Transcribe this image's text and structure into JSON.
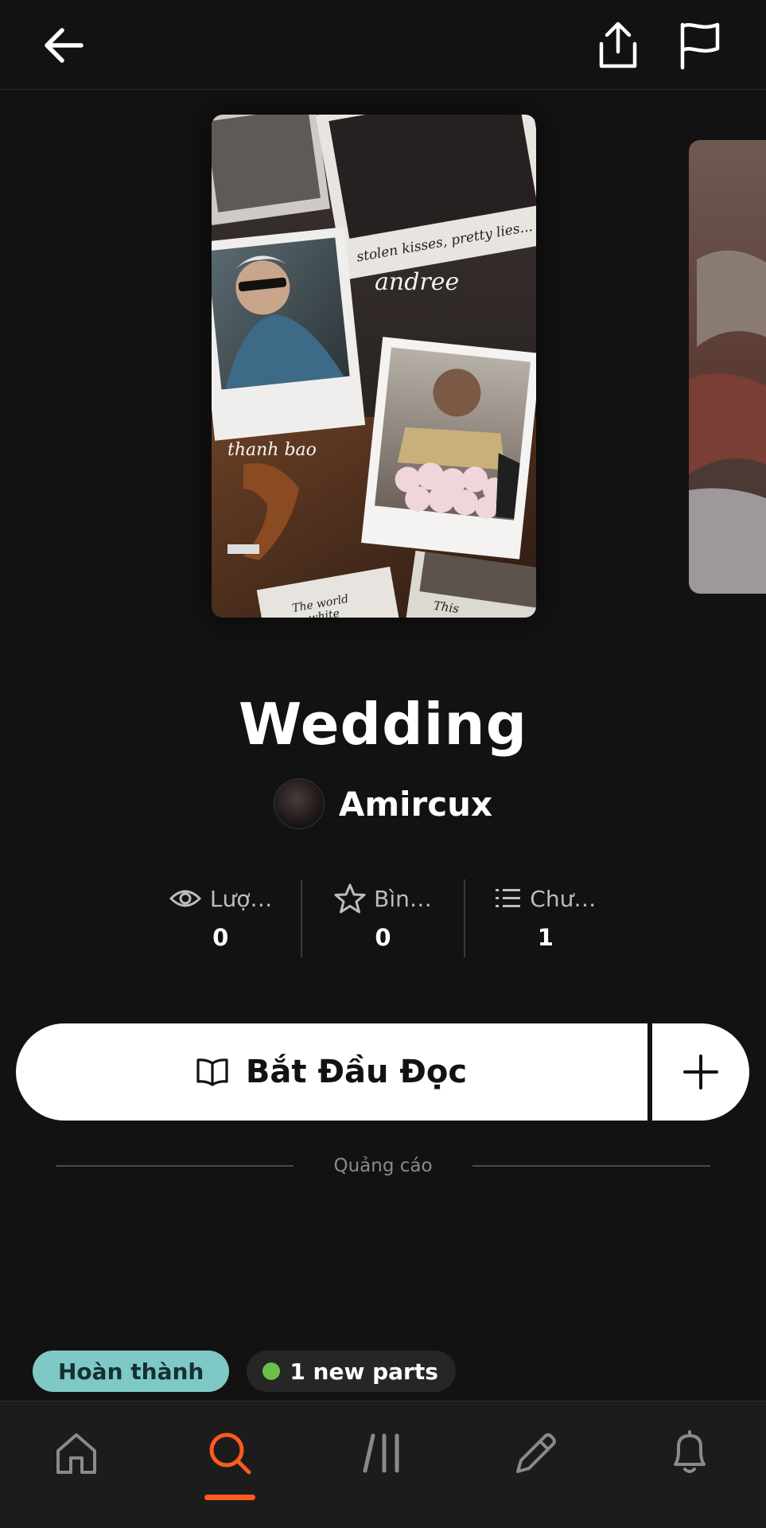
{
  "header": {
    "back_icon": "arrow-left-icon",
    "share_icon": "share-icon",
    "report_icon": "flag-icon"
  },
  "cover": {
    "texts": [
      "stolen kisses, pretty lies...",
      "andree",
      "thanh bao",
      "The world white",
      "This"
    ]
  },
  "story": {
    "title": "Wedding",
    "author": "Amircux"
  },
  "stats": [
    {
      "icon": "eye-icon",
      "label": "Lượ…",
      "value": "0"
    },
    {
      "icon": "star-icon",
      "label": "Bìn…",
      "value": "0"
    },
    {
      "icon": "list-icon",
      "label": "Chư…",
      "value": "1"
    }
  ],
  "actions": {
    "read_label": "Bắt Đầu Đọc",
    "read_icon": "book-icon",
    "add_icon": "plus-icon"
  },
  "ad": {
    "label": "Quảng cáo"
  },
  "tags": {
    "status": "Hoàn thành",
    "new_parts": "1 new parts"
  },
  "bottom_nav": {
    "items": [
      "home-icon",
      "search-icon",
      "library-icon",
      "write-icon",
      "bell-icon"
    ],
    "active": "search-icon",
    "accent": "#ff5a1f"
  }
}
